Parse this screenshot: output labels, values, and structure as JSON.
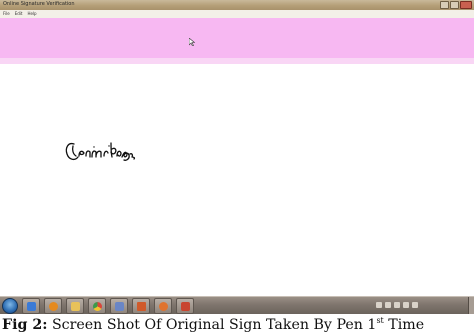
{
  "window": {
    "title": "Online Signature Verification",
    "controls": [
      "minimize",
      "maximize",
      "close"
    ]
  },
  "menu": {
    "items": [
      "File",
      "Edit",
      "Help"
    ]
  },
  "panel": {
    "line1": "",
    "line2": ""
  },
  "strip": {
    "text": ""
  },
  "signature": {
    "description": "handwritten signature drawn with pen"
  },
  "taskbar": {
    "pinned_icons": [
      "explorer-icon",
      "media-player-icon",
      "folder-icon",
      "chrome-icon",
      "paint-icon",
      "matlab-icon",
      "firefox-icon",
      "app-icon"
    ],
    "clock": {
      "time": "",
      "date": ""
    }
  },
  "caption": {
    "label": "Fig 2:",
    "text_before_sup": " Screen Shot Of Original Sign Taken By Pen 1",
    "sup": "st",
    "text_after_sup": " Time"
  },
  "colors": {
    "panel": "#f7b8f2",
    "taskbar": "#7f756d",
    "signature_ink": "#111111"
  }
}
